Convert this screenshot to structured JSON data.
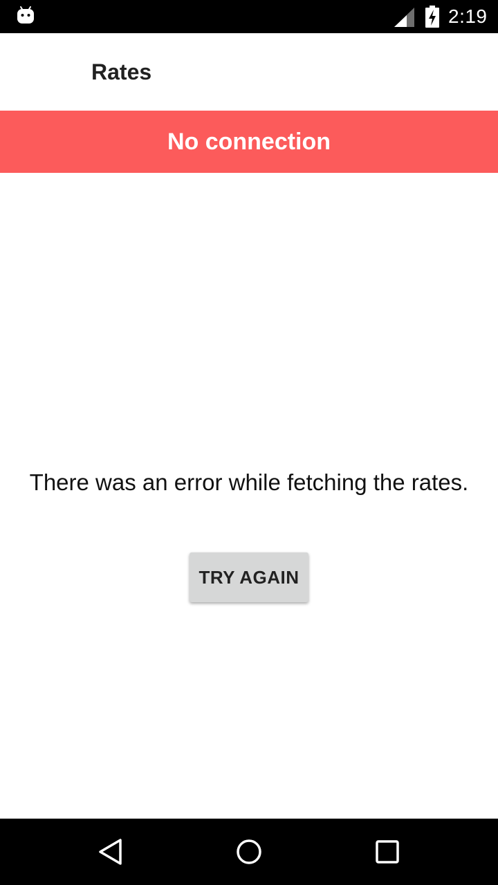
{
  "status_bar": {
    "time": "2:19",
    "left_icon": "android-notification-icon",
    "signal_icon": "cellular-signal-icon",
    "battery_icon": "battery-charging-icon"
  },
  "app_bar": {
    "title": "Rates"
  },
  "banner": {
    "text": "No connection",
    "color": "#fc5b5b"
  },
  "error": {
    "message": "There was an error while fetching the rates.",
    "button_label": "TRY AGAIN"
  },
  "nav_bar": {
    "back_icon": "back-triangle-icon",
    "home_icon": "home-circle-icon",
    "recents_icon": "recents-square-icon"
  }
}
